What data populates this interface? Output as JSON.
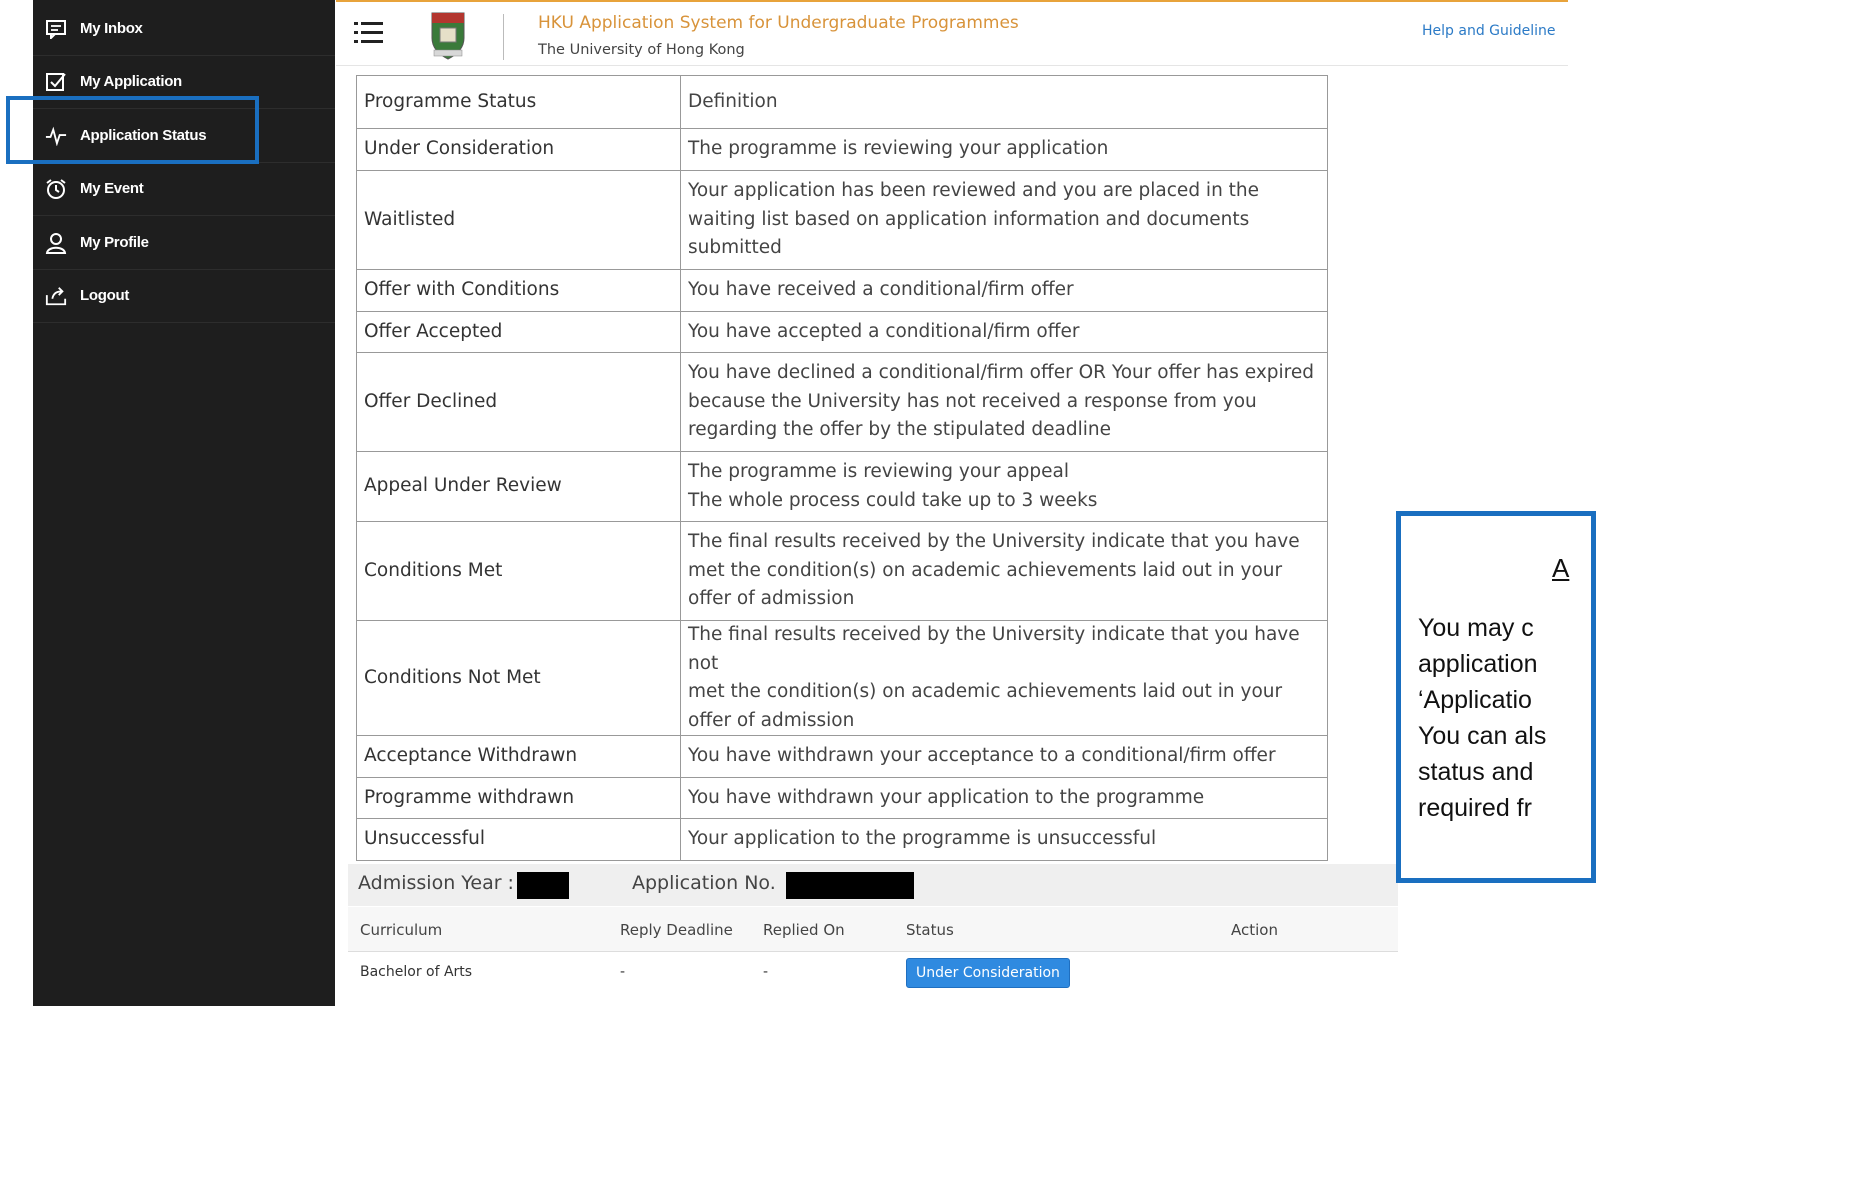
{
  "sidebar": {
    "items": [
      {
        "label": "My Inbox",
        "icon": "message-icon"
      },
      {
        "label": "My Application",
        "icon": "checkbox-icon"
      },
      {
        "label": "Application Status",
        "icon": "pulse-icon"
      },
      {
        "label": "My Event",
        "icon": "alarm-clock-icon"
      },
      {
        "label": "My Profile",
        "icon": "user-icon"
      },
      {
        "label": "Logout",
        "icon": "logout-icon"
      }
    ],
    "active_index": 2
  },
  "header": {
    "title": "HKU Application System for Undergraduate Programmes",
    "subtitle": "The University of Hong Kong",
    "help_link": "Help and Guideline"
  },
  "definitions": {
    "col_status": "Programme Status",
    "col_definition": "Definition",
    "rows": [
      {
        "status": "Under Consideration",
        "definition": [
          "The programme is reviewing your application"
        ]
      },
      {
        "status": "Waitlisted",
        "definition": [
          "Your application has been reviewed and you are placed in the",
          "waiting list based on application information and documents",
          "submitted"
        ]
      },
      {
        "status": "Offer with Conditions",
        "definition": [
          "You have received a conditional/firm offer"
        ]
      },
      {
        "status": "Offer Accepted",
        "definition": [
          "You have accepted a conditional/firm offer"
        ]
      },
      {
        "status": "Offer Declined",
        "definition": [
          "You have declined a conditional/firm offer OR Your offer has expired",
          "because the University has not received a response from you",
          "regarding the offer by the stipulated deadline"
        ]
      },
      {
        "status": "Appeal Under Review",
        "definition": [
          "The programme is reviewing your appeal",
          "The whole process could take up to 3 weeks"
        ]
      },
      {
        "status": "Conditions Met",
        "definition": [
          "The final results received by the University indicate that you have",
          "met the condition(s) on academic achievements laid out in your",
          "offer of admission"
        ]
      },
      {
        "status": "Conditions Not Met",
        "definition": [
          "The final results received by the University indicate that you have not",
          "met the condition(s) on academic achievements laid out in your",
          "offer of admission"
        ]
      },
      {
        "status": "Acceptance Withdrawn",
        "definition": [
          "You have withdrawn your acceptance to a conditional/firm offer"
        ]
      },
      {
        "status": "Programme withdrawn",
        "definition": [
          "You have withdrawn your application to the programme"
        ]
      },
      {
        "status": "Unsuccessful",
        "definition": [
          "Your application to the programme is unsuccessful"
        ]
      }
    ]
  },
  "application": {
    "admission_year_label": "Admission Year :",
    "application_no_label": "Application No.",
    "columns": {
      "curriculum": "Curriculum",
      "reply_deadline": "Reply Deadline",
      "replied_on": "Replied On",
      "status": "Status",
      "action": "Action"
    },
    "rows": [
      {
        "curriculum": "Bachelor of Arts",
        "reply_deadline": "-",
        "replied_on": "-",
        "status": "Under Consideration"
      }
    ]
  },
  "callout": {
    "title": "A",
    "lines": [
      "You may c",
      "application",
      "‘Applicatio",
      "You can als",
      "status and",
      "required fr"
    ]
  },
  "colors": {
    "sidebar_bg": "#1e1e1e",
    "highlight": "#1a6fc0",
    "title_orange": "#d8933a",
    "link_blue": "#2b7ac6",
    "status_button": "#2f8ae0"
  }
}
